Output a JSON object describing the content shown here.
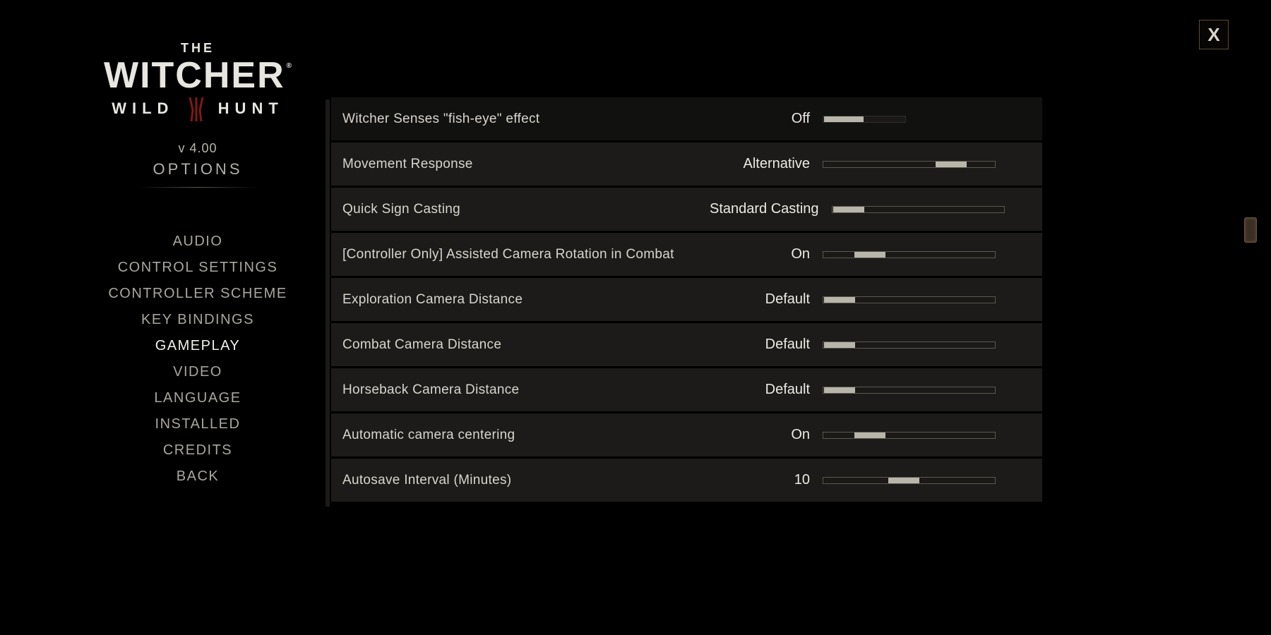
{
  "close_label": "X",
  "logo": {
    "the": "THE",
    "witcher": "WITCHER",
    "wild": "WILD",
    "hunt": "HUNT"
  },
  "version": "v 4.00",
  "options_title": "OPTIONS",
  "menu": {
    "items": [
      {
        "label": "AUDIO"
      },
      {
        "label": "CONTROL SETTINGS"
      },
      {
        "label": "CONTROLLER SCHEME"
      },
      {
        "label": "KEY BINDINGS"
      },
      {
        "label": "GAMEPLAY",
        "active": true
      },
      {
        "label": "VIDEO"
      },
      {
        "label": "LANGUAGE"
      },
      {
        "label": "INSTALLED"
      },
      {
        "label": "CREDITS"
      },
      {
        "label": "BACK"
      }
    ]
  },
  "settings": [
    {
      "label": "Witcher Senses \"fish-eye\" effect",
      "value": "Off",
      "fill": 0.0,
      "short": true
    },
    {
      "label": "Movement Response",
      "value": "Alternative",
      "fill": 0.8,
      "selected": true
    },
    {
      "label": "Quick Sign Casting",
      "value": "Standard Casting",
      "fill": 0.0,
      "selected": true
    },
    {
      "label": "[Controller Only] Assisted Camera Rotation in Combat",
      "value": "On",
      "fill": 0.22,
      "selected": true
    },
    {
      "label": "Exploration Camera Distance",
      "value": "Default",
      "fill": 0.0,
      "selected": true
    },
    {
      "label": "Combat Camera Distance",
      "value": "Default",
      "fill": 0.0,
      "selected": true
    },
    {
      "label": "Horseback Camera Distance",
      "value": "Default",
      "fill": 0.0,
      "selected": true
    },
    {
      "label": "Automatic camera centering",
      "value": "On",
      "fill": 0.22,
      "selected": true
    },
    {
      "label": "Autosave Interval (Minutes)",
      "value": "10",
      "fill": 0.46,
      "selected": true
    }
  ]
}
